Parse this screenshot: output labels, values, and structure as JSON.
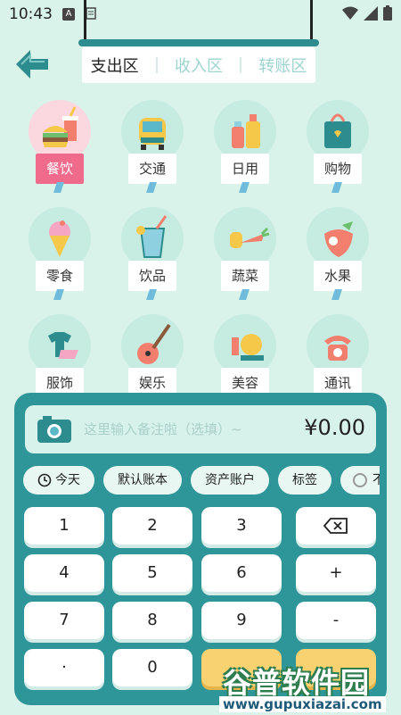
{
  "status": {
    "time": "10:43",
    "notify_badge": "A"
  },
  "tabs": [
    {
      "label": "支出区",
      "active": true
    },
    {
      "label": "收入区",
      "active": false
    },
    {
      "label": "转账区",
      "active": false
    }
  ],
  "categories": [
    {
      "label": "餐饮",
      "icon": "burger-drink-icon",
      "active": true
    },
    {
      "label": "交通",
      "icon": "car-icon",
      "active": false
    },
    {
      "label": "日用",
      "icon": "bottles-icon",
      "active": false
    },
    {
      "label": "购物",
      "icon": "shopping-bag-icon",
      "active": false
    },
    {
      "label": "零食",
      "icon": "ice-cream-icon",
      "active": false
    },
    {
      "label": "饮品",
      "icon": "drink-cup-icon",
      "active": false
    },
    {
      "label": "蔬菜",
      "icon": "vegetable-icon",
      "active": false
    },
    {
      "label": "水果",
      "icon": "strawberry-icon",
      "active": false
    },
    {
      "label": "服饰",
      "icon": "clothes-icon",
      "active": false
    },
    {
      "label": "娱乐",
      "icon": "guitar-icon",
      "active": false
    },
    {
      "label": "美容",
      "icon": "makeup-icon",
      "active": false
    },
    {
      "label": "通讯",
      "icon": "telephone-icon",
      "active": false
    }
  ],
  "note": {
    "placeholder": "这里输入备注啦（选填）~",
    "amount": "¥0.00"
  },
  "options": [
    "今天",
    "默认账本",
    "资产账户",
    "标签",
    "不"
  ],
  "keys": [
    "1",
    "2",
    "3",
    "⌫",
    "4",
    "5",
    "6",
    "+",
    "7",
    "8",
    "9",
    "-",
    "·",
    "0",
    "",
    ""
  ],
  "watermark": {
    "title": "谷普软件园",
    "url": "www.gupuxiazai.com"
  },
  "colors": {
    "accent": "#2e9598",
    "active_category": "#f06a8c",
    "background": "#d9f3ea"
  }
}
